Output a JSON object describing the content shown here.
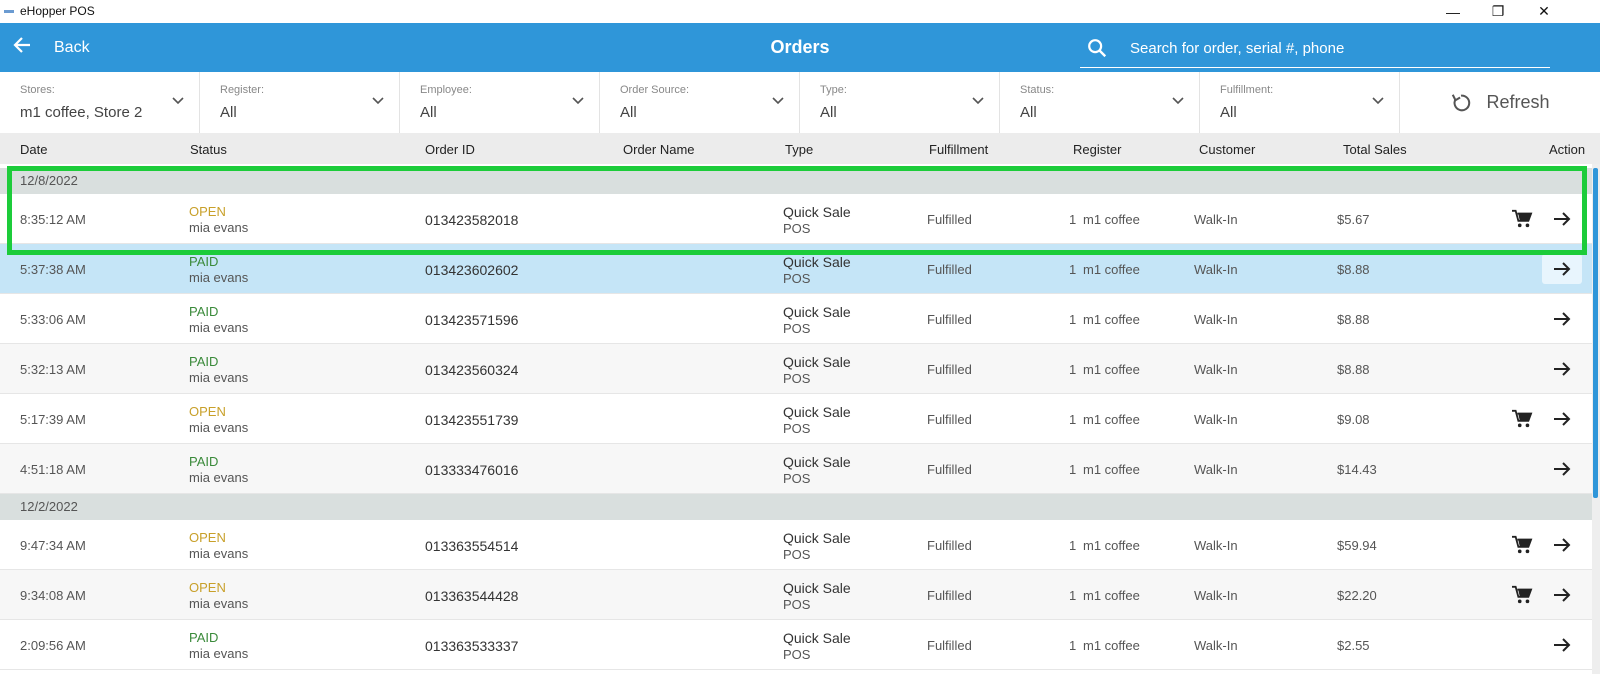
{
  "window": {
    "title": "eHopper POS",
    "minimize": "—",
    "maximize": "❐",
    "close": "✕"
  },
  "header": {
    "back_label": "Back",
    "title": "Orders",
    "search_placeholder": "Search for order, serial #, phone"
  },
  "filters": [
    {
      "label": "Stores:",
      "value": "m1 coffee, Store 2"
    },
    {
      "label": "Register:",
      "value": "All"
    },
    {
      "label": "Employee:",
      "value": "All"
    },
    {
      "label": "Order Source:",
      "value": "All"
    },
    {
      "label": "Type:",
      "value": "All"
    },
    {
      "label": "Status:",
      "value": "All"
    },
    {
      "label": "Fulfillment:",
      "value": "All"
    }
  ],
  "refresh_label": "Refresh",
  "columns": [
    "Date",
    "Status",
    "Order ID",
    "Order Name",
    "Type",
    "Fulfillment",
    "Register",
    "Customer",
    "Total Sales",
    "Action"
  ],
  "groups": [
    "12/8/2022",
    "12/2/2022"
  ],
  "orders": [
    {
      "time": "8:35:12 AM",
      "status": "OPEN",
      "employee": "mia evans",
      "order_id": "013423582018",
      "type": "Quick Sale",
      "source": "POS",
      "fulfillment": "Fulfilled",
      "register_no": "1",
      "register": "m1 coffee",
      "customer": "Walk-In",
      "total": "$5.67"
    },
    {
      "time": "5:37:38 AM",
      "status": "PAID",
      "employee": "mia evans",
      "order_id": "013423602602",
      "type": "Quick Sale",
      "source": "POS",
      "fulfillment": "Fulfilled",
      "register_no": "1",
      "register": "m1 coffee",
      "customer": "Walk-In",
      "total": "$8.88"
    },
    {
      "time": "5:33:06 AM",
      "status": "PAID",
      "employee": "mia evans",
      "order_id": "013423571596",
      "type": "Quick Sale",
      "source": "POS",
      "fulfillment": "Fulfilled",
      "register_no": "1",
      "register": "m1 coffee",
      "customer": "Walk-In",
      "total": "$8.88"
    },
    {
      "time": "5:32:13 AM",
      "status": "PAID",
      "employee": "mia evans",
      "order_id": "013423560324",
      "type": "Quick Sale",
      "source": "POS",
      "fulfillment": "Fulfilled",
      "register_no": "1",
      "register": "m1 coffee",
      "customer": "Walk-In",
      "total": "$8.88"
    },
    {
      "time": "5:17:39 AM",
      "status": "OPEN",
      "employee": "mia evans",
      "order_id": "013423551739",
      "type": "Quick Sale",
      "source": "POS",
      "fulfillment": "Fulfilled",
      "register_no": "1",
      "register": "m1 coffee",
      "customer": "Walk-In",
      "total": "$9.08"
    },
    {
      "time": "4:51:18 AM",
      "status": "PAID",
      "employee": "mia evans",
      "order_id": "013333476016",
      "type": "Quick Sale",
      "source": "POS",
      "fulfillment": "Fulfilled",
      "register_no": "1",
      "register": "m1 coffee",
      "customer": "Walk-In",
      "total": "$14.43"
    },
    {
      "time": "9:47:34 AM",
      "status": "OPEN",
      "employee": "mia evans",
      "order_id": "013363554514",
      "type": "Quick Sale",
      "source": "POS",
      "fulfillment": "Fulfilled",
      "register_no": "1",
      "register": "m1 coffee",
      "customer": "Walk-In",
      "total": "$59.94"
    },
    {
      "time": "9:34:08 AM",
      "status": "OPEN",
      "employee": "mia evans",
      "order_id": "013363544428",
      "type": "Quick Sale",
      "source": "POS",
      "fulfillment": "Fulfilled",
      "register_no": "1",
      "register": "m1 coffee",
      "customer": "Walk-In",
      "total": "$22.20"
    },
    {
      "time": "2:09:56 AM",
      "status": "PAID",
      "employee": "mia evans",
      "order_id": "013363533337",
      "type": "Quick Sale",
      "source": "POS",
      "fulfillment": "Fulfilled",
      "register_no": "1",
      "register": "m1 coffee",
      "customer": "Walk-In",
      "total": "$2.55"
    }
  ],
  "colors": {
    "accent": "#2f96d9",
    "open": "#c8a02a",
    "paid": "#3a8a3a",
    "selection": "#1ccc3a",
    "highlight_row": "#c5e5f7"
  },
  "icons": {
    "back": "arrow-left-icon",
    "search": "search-icon",
    "dropdown": "chevron-down-icon",
    "refresh": "refresh-icon",
    "cart": "cart-icon",
    "open_order": "arrow-right-icon"
  }
}
